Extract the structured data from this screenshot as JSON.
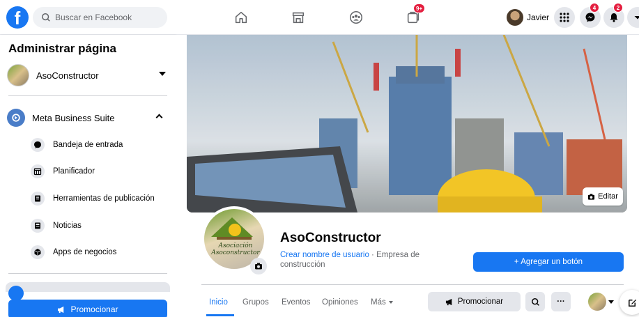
{
  "topbar": {
    "logo": "f",
    "search_placeholder": "Buscar en Facebook",
    "tab_icons": [
      "home-icon",
      "store-icon",
      "groups-icon",
      "pages-icon"
    ],
    "pages_badge": "9+",
    "profile_name": "Javier",
    "messenger_badge": "4",
    "notifications_badge": "2"
  },
  "sidebar": {
    "title": "Administrar página",
    "page_name": "AsoConstructor",
    "suite_label": "Meta Business Suite",
    "items": [
      {
        "label": "Bandeja de entrada",
        "icon": "chat-icon"
      },
      {
        "label": "Planificador",
        "icon": "calendar-icon"
      },
      {
        "label": "Herramientas de publicación",
        "icon": "publishing-icon"
      },
      {
        "label": "Noticias",
        "icon": "news-icon"
      },
      {
        "label": "Apps de negocios",
        "icon": "box-icon"
      }
    ],
    "promote_label": "Promocionar"
  },
  "main": {
    "edit_cover_label": "Editar",
    "profile_logo_text": "Asociación Asoconstructor",
    "page_name": "AsoConstructor",
    "username_link": "Crear nombre de usuario",
    "category": " · Empresa de construcción",
    "add_button_label": "+ Agregar un botón",
    "tabs": [
      "Inicio",
      "Grupos",
      "Eventos",
      "Opiniones",
      "Más"
    ],
    "promote_label": "Promocionar",
    "more_label": "···"
  },
  "colors": {
    "accent": "#1877f2",
    "badge": "#e41e3f",
    "secondary_text": "#65676b",
    "button_gray": "#e4e6eb"
  }
}
